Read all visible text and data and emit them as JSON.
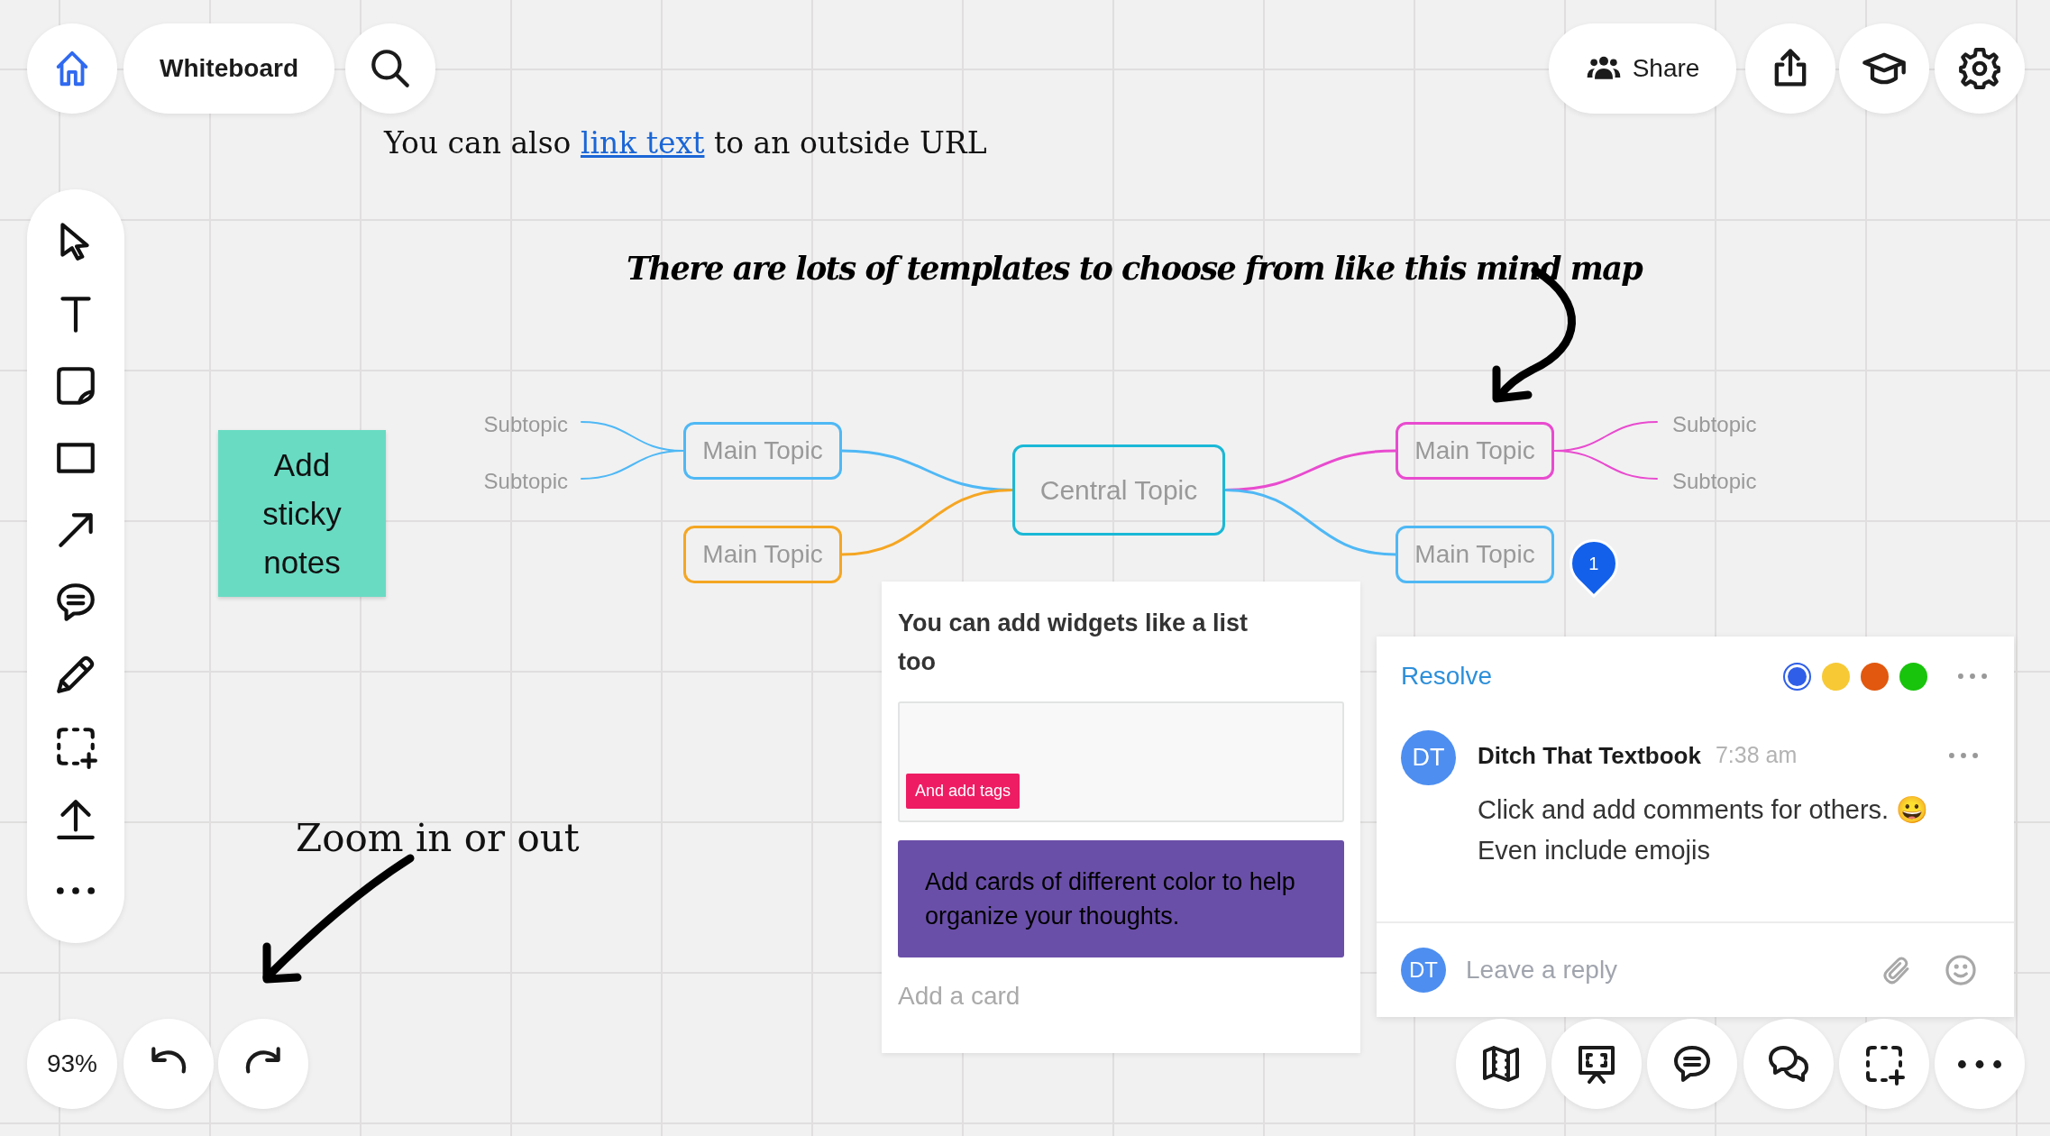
{
  "top_bar": {
    "board_title": "Whiteboard",
    "share_label": "Share"
  },
  "link_note": {
    "before": "You can also ",
    "link": "link text",
    "after": " to an outside URL"
  },
  "template_note": "There are lots of templates to choose from like this mind map",
  "sticky_note": "Add sticky notes",
  "mind_map": {
    "central": "Central Topic",
    "left_topics": [
      {
        "label": "Main Topic",
        "color": "#4fb8f5",
        "subtopics": [
          "Subtopic",
          "Subtopic"
        ]
      },
      {
        "label": "Main Topic",
        "color": "#f5a623"
      }
    ],
    "right_topics": [
      {
        "label": "Main Topic",
        "color": "#e84bcf",
        "subtopics": [
          "Subtopic",
          "Subtopic"
        ]
      },
      {
        "label": "Main Topic",
        "color": "#4fb8f5"
      }
    ]
  },
  "pin": {
    "count": "1"
  },
  "list_widget": {
    "title": "You can add widgets like a list too",
    "cards": [
      {
        "kind": "tag-card",
        "tags": [
          {
            "label": "And add tags",
            "color": "#ee1c63"
          }
        ]
      },
      {
        "kind": "color-card",
        "text": "Add cards of different color to help organize your thoughts.",
        "color": "#6a4fa8"
      }
    ],
    "add_card": "Add a card"
  },
  "comment": {
    "resolve": "Resolve",
    "colors": [
      {
        "color": "#2f5fe8",
        "selected": true
      },
      {
        "color": "#f7c935",
        "selected": false
      },
      {
        "color": "#e1580e",
        "selected": false
      },
      {
        "color": "#18c40c",
        "selected": false
      }
    ],
    "initials": "DT",
    "author": "Ditch That Textbook",
    "time": "7:38 am",
    "text": "Click and add comments for others. 😀\nEven include emojis",
    "reply": {
      "initials": "DT",
      "placeholder": "Leave a reply"
    }
  },
  "zoom_note": "Zoom in or out",
  "zoom_level": "93%"
}
